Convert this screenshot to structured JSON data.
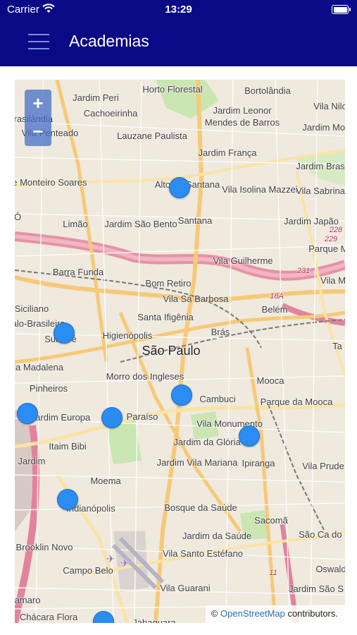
{
  "status_bar": {
    "carrier": "Carrier",
    "time": "13:29"
  },
  "nav": {
    "title": "Academias"
  },
  "map": {
    "zoom_in": "+",
    "zoom_out": "−",
    "attribution": {
      "symbol": "©",
      "link": "OpenStreetMap",
      "suffix": "contributors."
    },
    "labels": {
      "horto_florestal": "Horto Florestal",
      "bortolandia": "Bortolândia",
      "vila_nilo": "Vila Nilo",
      "jardim_peri": "Jardim Peri",
      "cachoeirinha": "Cachoeirinha",
      "jardim_leonor": "Jardim Leonor",
      "mendes_de_barros": "Mendes de Barros",
      "jardim_modelo": "Jardim Mode",
      "brasilandia": "Brasilândia",
      "vila_penteado": "Vila Penteado",
      "lauzane_paulista": "Lauzane Paulista",
      "jardim_franca": "Jardim França",
      "jardim_brasil": "Jardim Bras",
      "parque_monteiro_soares": "Parque Monteiro Soares",
      "alto_de_santana": "Alto de Santana",
      "vila_isolina_mazzei": "Vila Isolina Mazzei",
      "vila_sabrina": "Vila Sabrina",
      "limao": "Limão",
      "jardim_sao_bento": "Jardim São Bento",
      "santana": "Santana",
      "jardim_japao": "Jardim Japão",
      "freguesia_do_o": "Ó",
      "parque_novo_mundo": "Parque Mu",
      "barra_funda": "Barra Funda",
      "vila_guilherme": "Vila Guilherme",
      "bom_retiro": "Bom Retiro",
      "vila_maria": "Vila M",
      "siciliano": "Siciliano",
      "vila_sa_barbosa": "Vila Sá Barbosa",
      "belem": "Belém",
      "italo_brasileira": "Italo-Brasileira",
      "sumare": "Sumaré",
      "santa_ifigenia": "Santa Ifigênia",
      "higienopolis": "Higienópolis",
      "bras": "Brás",
      "vila_madalena": "Vila Madalena",
      "sao_paulo": "São Paulo",
      "tatuape": "Ta",
      "morro_dos_ingleses": "Morro dos Ingleses",
      "pinheiros": "Pinheiros",
      "mooca": "Mooca",
      "cambuci": "Cambuci",
      "jardim_europa": "Jardim Europa",
      "paraiso": "Paraíso",
      "parque_da_mooca": "Parque da Mooca",
      "vila_monumento": "Vila Monumento",
      "itaim_bibi": "Itaim Bibi",
      "jardim_da_gloria": "Jardim da Glória",
      "jardim": "Jardim",
      "jardim_vila_mariana": "Jardim Vila Mariana",
      "ipiranga": "Ipiranga",
      "vila_prudente": "Vila Prude",
      "moema": "Moema",
      "indianopolis": "Indianópolis",
      "bosque_da_saude": "Bosque da Saúde",
      "sacoma": "Sacomã",
      "brooklin_novo": "Brooklin Novo",
      "jardim_da_saude": "Jardim da Saúde",
      "sao_caetano": "São Ca do S",
      "campo_belo": "Campo Belo",
      "vila_santo_estefano": "Vila Santo Estéfano",
      "oswaldo": "Oswald",
      "vila_guarani": "Vila Guarani",
      "jardim_sao_s": "Jardim São S",
      "amaro": "amaro",
      "chacara_flora": "Chácara Flora",
      "jabaquara": "Jabaquara",
      "road_228": "228",
      "road_229": "229",
      "road_231": "231",
      "road_18a": "18A",
      "road_11": "11"
    }
  }
}
